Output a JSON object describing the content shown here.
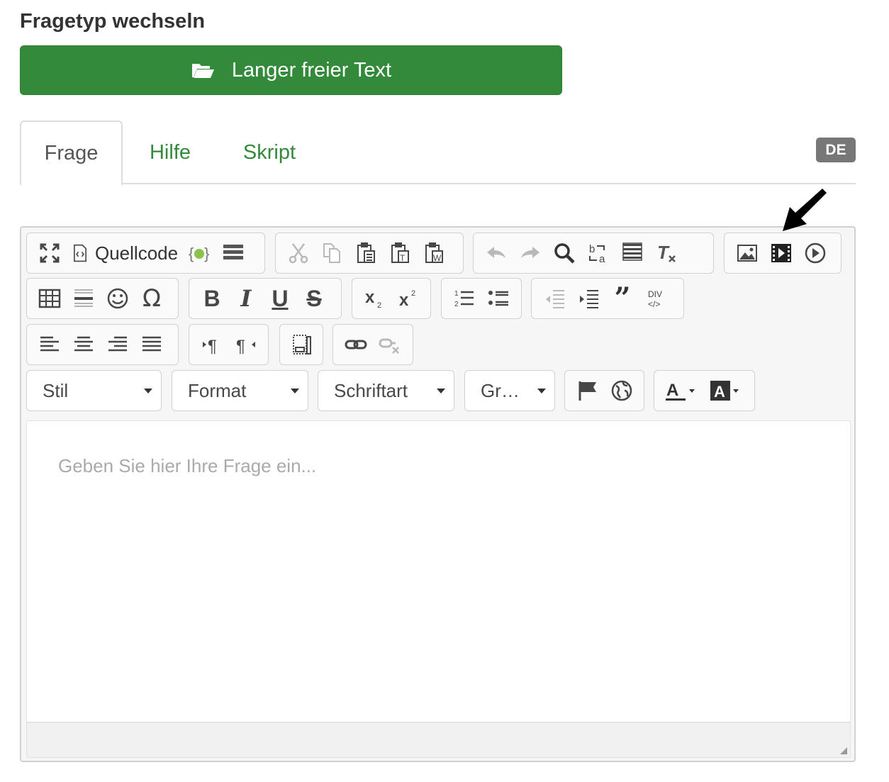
{
  "question_type": {
    "label": "Fragetyp wechseln",
    "button_label": "Langer freier Text",
    "button_color": "#338a3a"
  },
  "tabs": [
    {
      "label": "Frage",
      "active": true
    },
    {
      "label": "Hilfe",
      "active": false
    },
    {
      "label": "Skript",
      "active": false
    }
  ],
  "language_badge": "DE",
  "toolbar": {
    "source_label": "Quellcode",
    "style_combo": "Stil",
    "format_combo": "Format",
    "font_combo": "Schriftart",
    "size_combo": "Gr…",
    "icons": [
      "maximize-icon",
      "source-icon",
      "code-snippet-icon",
      "template-icon",
      "cut-icon",
      "copy-icon",
      "paste-icon",
      "paste-text-icon",
      "paste-word-icon",
      "undo-icon",
      "redo-icon",
      "find-icon",
      "replace-icon",
      "select-all-icon",
      "remove-format-icon",
      "image-icon",
      "video-icon",
      "media-embed-icon",
      "table-icon",
      "horizontal-rule-icon",
      "smiley-icon",
      "special-char-icon",
      "bold-icon",
      "italic-icon",
      "underline-icon",
      "strike-icon",
      "subscript-icon",
      "superscript-icon",
      "numbered-list-icon",
      "bulleted-list-icon",
      "outdent-icon",
      "indent-icon",
      "blockquote-icon",
      "div-icon",
      "align-left-icon",
      "align-center-icon",
      "align-right-icon",
      "justify-icon",
      "ltr-icon",
      "rtl-icon",
      "iframe-icon",
      "link-icon",
      "unlink-icon",
      "anchor-icon",
      "language-icon",
      "text-color-icon",
      "bg-color-icon"
    ]
  },
  "editor": {
    "placeholder": "Geben Sie hier Ihre Frage ein..."
  }
}
